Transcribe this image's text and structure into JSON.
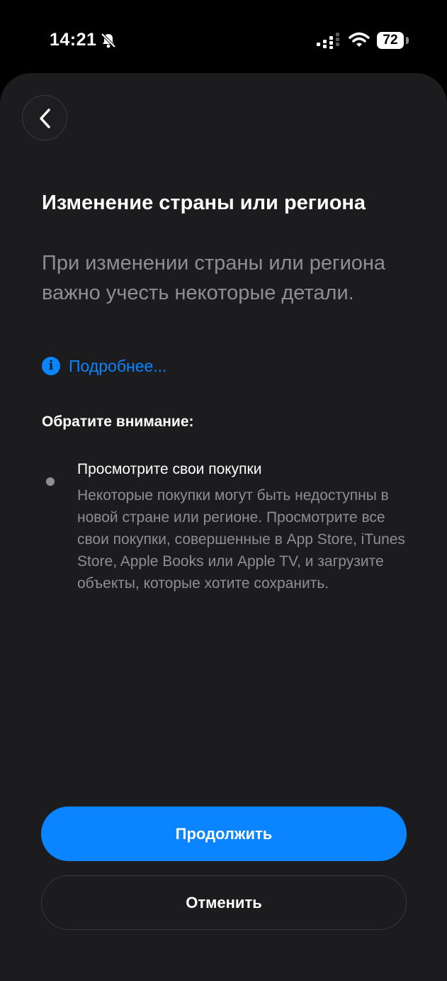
{
  "status_bar": {
    "time": "14:21",
    "battery": "72",
    "icons": [
      "bell-slash-icon",
      "cellular-signal-icon",
      "wifi-icon",
      "battery-icon"
    ]
  },
  "nav": {
    "back_icon": "chevron-left-icon"
  },
  "content": {
    "title": "Изменение страны или региона",
    "subtitle": "При изменении страны или региона важно учесть некоторые детали.",
    "more_link": "Подробнее...",
    "more_icon": "info-circle-icon",
    "section_heading": "Обратите внимание:",
    "items": [
      {
        "title": "Просмотрите свои покупки",
        "body": "Некоторые покупки могут быть недоступны в новой стране или регионе. Просмотрите все свои покупки, совершенные в App Store, iTunes Store, Apple Books или Apple TV, и загрузите объекты, которые хотите сохранить."
      }
    ]
  },
  "actions": {
    "continue_label": "Продолжить",
    "cancel_label": "Отменить"
  },
  "colors": {
    "accent": "#0a84ff",
    "background": "#1c1c1e",
    "secondary_text": "#8e8e93"
  }
}
